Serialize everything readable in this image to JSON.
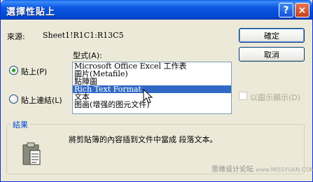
{
  "window": {
    "title": "選擇性貼上"
  },
  "titlebar": {
    "help_label": "?",
    "close_label": "×"
  },
  "source": {
    "label": "來源:",
    "value": "Sheet1!R1C1:R13C5"
  },
  "format": {
    "label": "型式(A):"
  },
  "options": {
    "paste_label": "貼上(P)",
    "paste_link_label": "貼上連結(L)",
    "paste_selected": true
  },
  "list": {
    "items": [
      "Microsoft Office Excel 工作表",
      "圖片(Metafile)",
      "點陣圖",
      "Rich Text Format",
      "文本",
      "图画(增强的图元文件)"
    ],
    "selected_index": 3
  },
  "buttons": {
    "ok": "確定",
    "cancel": "取消"
  },
  "display_as_icon": {
    "label": "以圖示顯示(D)",
    "checked": false,
    "enabled": false
  },
  "result": {
    "title": "結果",
    "text": "將剪貼簿的內容插到文件中當成 段落文本。"
  },
  "watermark": {
    "text": "思缘设计论坛",
    "site": "www.MISSYUAN.COM"
  },
  "colors": {
    "title_bar": "#0054e3",
    "selection": "#316ac5",
    "dialog_bg": "#ece9d8",
    "group_title": "#0046d5"
  },
  "icons": {
    "result_icon": "clipboard-icon",
    "pointer": "arrow-cursor-icon"
  }
}
